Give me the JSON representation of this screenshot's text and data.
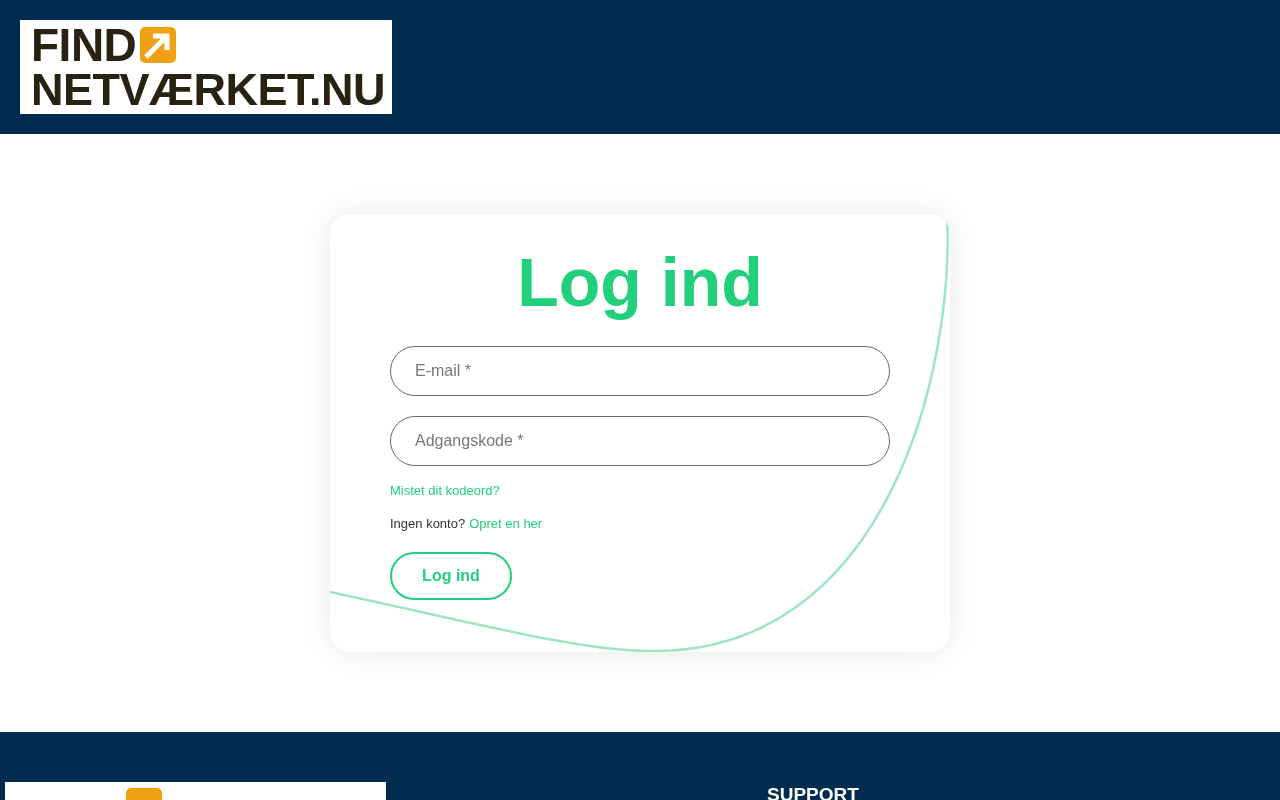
{
  "header": {
    "logo": {
      "line_1": "FIND",
      "line_2": "NETVÆRKET.NU"
    }
  },
  "login": {
    "title": "Log ind",
    "fields": [
      {
        "placeholder": "E-mail *"
      },
      {
        "placeholder": "Adgangskode *"
      }
    ],
    "forgot_link": "Mistet dit kodeord?",
    "signup_prompt": "Ingen konto?",
    "signup_link": "Opret en her",
    "submit": "Log ind"
  },
  "footer": {
    "support_heading": "SUPPORT"
  }
}
